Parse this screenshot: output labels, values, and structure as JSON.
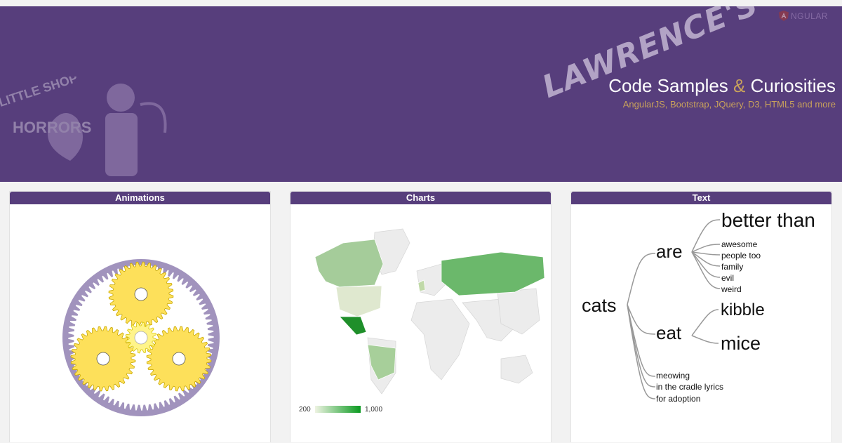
{
  "banner": {
    "angular_logo_text": "NGULAR",
    "scribble": "LAWRENCE'S",
    "title_part1": "Code Samples",
    "title_amp": "&",
    "title_part2": "Curiosities",
    "subtitle": "AngularJS, Bootstrap, JQuery, D3, HTML5 and more",
    "poster_text": "LITTLE SHOP OF HORRORS",
    "colors": {
      "banner": "#573e7c",
      "accent": "#c9a25b"
    }
  },
  "panels": [
    {
      "title": "Animations"
    },
    {
      "title": "Charts"
    },
    {
      "title": "Text"
    }
  ],
  "map": {
    "legend_min": "200",
    "legend_max": "1,000",
    "colors": {
      "low": "#e6ecd6",
      "high": "#0a9a20",
      "none": "#f0f0f0"
    }
  },
  "tree": {
    "root": "cats",
    "are": "are",
    "are_children": [
      "better than",
      "awesome",
      "people too",
      "family",
      "evil",
      "weird"
    ],
    "eat": "eat",
    "eat_children": [
      "kibble",
      "mice"
    ],
    "leaf_children": [
      "meowing",
      "in the cradle lyrics",
      "for adoption"
    ]
  }
}
